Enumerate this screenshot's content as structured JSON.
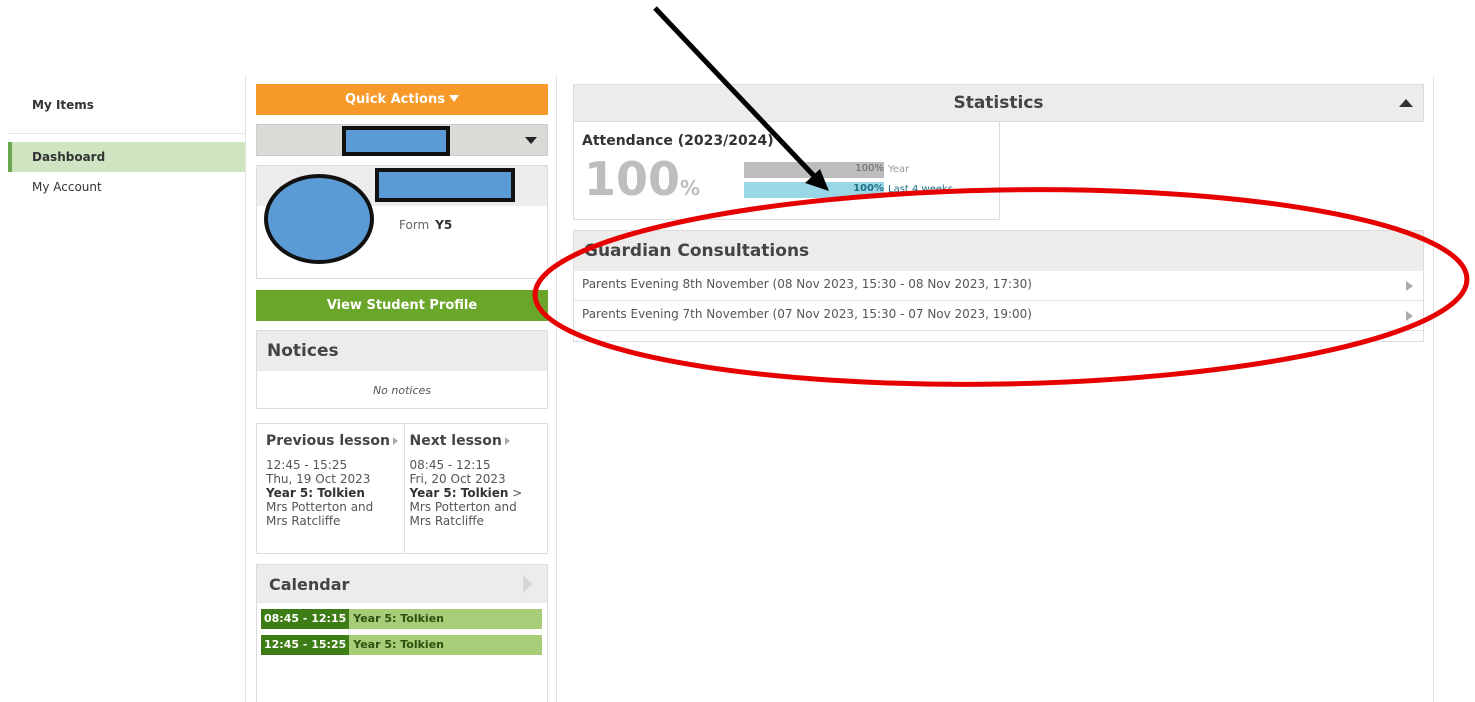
{
  "sidebar": {
    "header": "My Items",
    "items": [
      {
        "label": "Dashboard",
        "active": true
      },
      {
        "label": "My Account",
        "active": false
      }
    ]
  },
  "quick_actions": {
    "label": "Quick Actions"
  },
  "student": {
    "form_label": "Form",
    "form_value": "Y5"
  },
  "view_profile": {
    "label": "View Student Profile"
  },
  "notices": {
    "title": "Notices",
    "empty_text": "No notices"
  },
  "previous_lesson": {
    "title": "Previous lesson",
    "time": "12:45 - 15:25",
    "date": "Thu, 19 Oct 2023",
    "subject": "Year 5: Tolkien",
    "teacher_line1": "Mrs Potterton and",
    "teacher_line2": "Mrs Ratcliffe"
  },
  "next_lesson": {
    "title": "Next lesson",
    "time": "08:45 - 12:15",
    "date": "Fri, 20 Oct 2023",
    "subject": "Year 5: Tolkien",
    "subject_suffix": " >",
    "teacher_line1": "Mrs Potterton and",
    "teacher_line2": "Mrs Ratcliffe"
  },
  "calendar": {
    "title": "Calendar",
    "events": [
      {
        "time": "08:45 - 12:15",
        "title": "Year 5: Tolkien"
      },
      {
        "time": "12:45 - 15:25",
        "title": "Year 5: Tolkien"
      }
    ]
  },
  "statistics": {
    "title": "Statistics",
    "attendance_title": "Attendance (2023/2024)",
    "attendance_value": "100",
    "attendance_unit": "%",
    "bars": [
      {
        "value_text": "100%",
        "label": "Year",
        "fill_fraction": 1.0,
        "color": "#bdbdbd"
      },
      {
        "value_text": "100%",
        "label": "Last 4 weeks",
        "fill_fraction": 1.0,
        "color": "#9ad7e6"
      }
    ]
  },
  "guardian_consultations": {
    "title": "Guardian Consultations",
    "items": [
      {
        "label": "Parents Evening 8th November (08 Nov 2023, 15:30 - 08 Nov 2023, 17:30)"
      },
      {
        "label": "Parents Evening 7th November (07 Nov 2023, 15:30 - 07 Nov 2023, 19:00)"
      }
    ]
  },
  "annotations": {
    "arrow_color": "#000000",
    "ellipse_color": "#e60000"
  }
}
